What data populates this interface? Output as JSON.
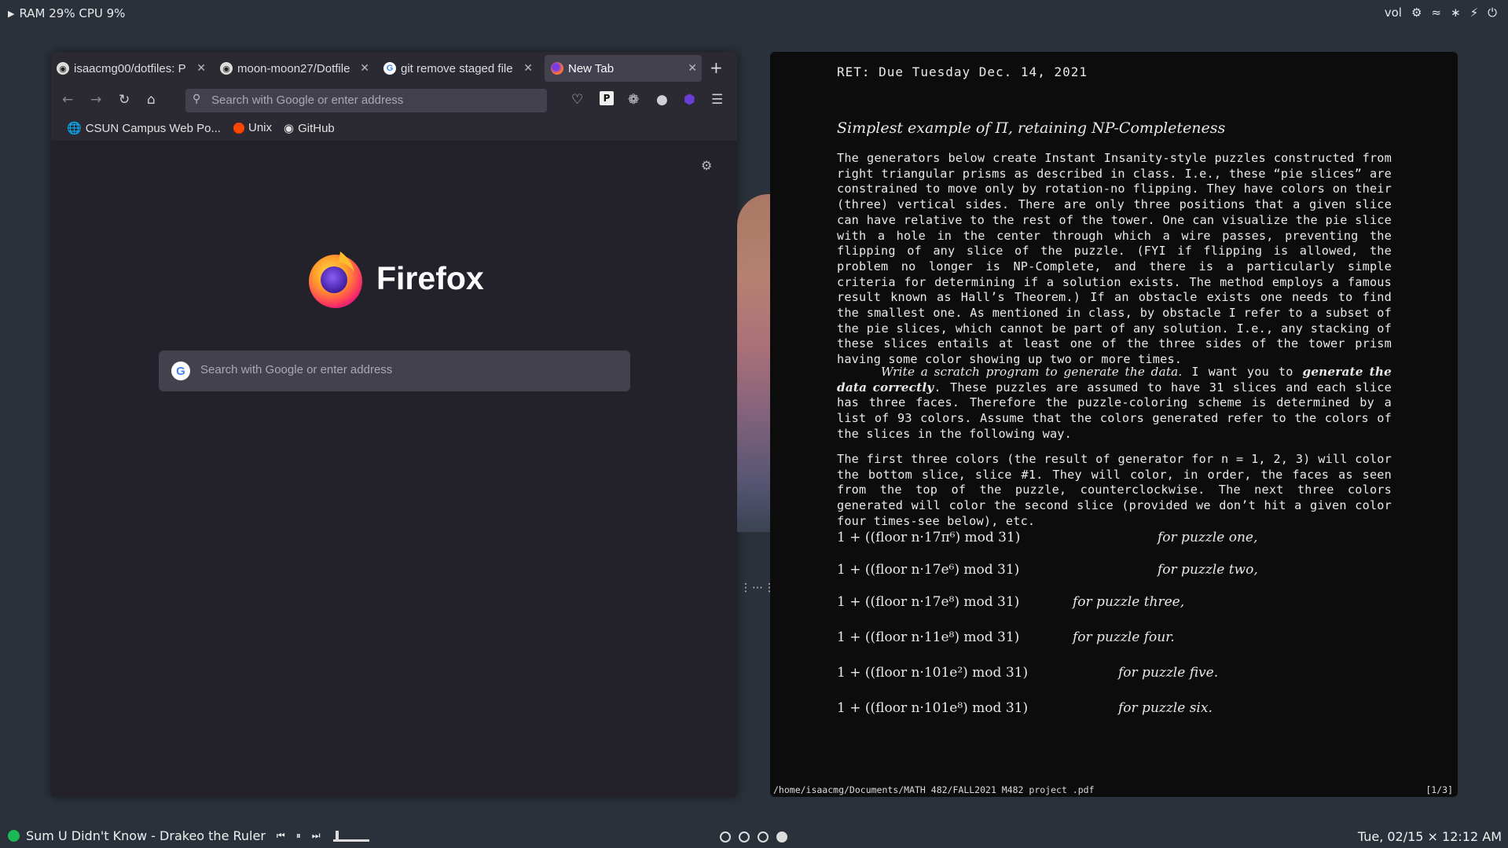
{
  "topbar": {
    "sysstat": "RAM 29% CPU 9%",
    "tray_vol": "vol"
  },
  "firefox": {
    "tabs": [
      {
        "label": "isaacmg00/dotfiles: P",
        "icon": "github-icon"
      },
      {
        "label": "moon-moon27/Dotfile",
        "icon": "github-icon"
      },
      {
        "label": "git remove staged file",
        "icon": "google-icon"
      },
      {
        "label": "New Tab",
        "icon": "firefox-icon"
      }
    ],
    "urlbar_placeholder": "Search with Google or enter address",
    "bookmarks": [
      {
        "label": "CSUN Campus Web Po..."
      },
      {
        "label": "Unix"
      },
      {
        "label": "GitHub"
      }
    ],
    "brand": "Firefox",
    "search_placeholder": "Search with Google or enter address"
  },
  "pdf": {
    "ret": "RET: Due Tuesday Dec. 14, 2021",
    "section_title": "Simplest example of Π, retaining NP-Completeness",
    "para1": "The generators below create Instant Insanity-style puzzles constructed from right triangular prisms as described in class. I.e., these “pie slices” are constrained to move only by rotation-no flipping. They have colors on their (three) vertical sides. There are only three positions that a given slice can have relative to the rest of the tower. One can visualize the pie slice with a hole in the center through which a wire passes, preventing the flipping of any slice of the puzzle. (FYI if flipping is allowed, the problem no longer is NP-Complete, and there is a particularly simple criteria for determining if a solution exists. The method employs a famous result known as Hall’s Theorem.) If an obstacle exists one needs to find the smallest one. As mentioned in class, by obstacle I refer to a subset of the pie slices, which cannot be part of any solution. I.e., any stacking of these slices entails at least one of the three sides of the tower prism having some color showing up two or more times.",
    "para2_italic": "Write a scratch program to generate the data.",
    "para2_mid": " I want you to ",
    "para2_bold": "generate the data correctly",
    "para2_rest": ". These puzzles are assumed to have 31 slices and each slice has three faces. Therefore the puzzle-coloring scheme is determined by a list of 93 colors. Assume that the colors generated refer to the colors of the slices in the following way.",
    "para3": "The first three colors (the result of generator for n = 1, 2, 3) will color the bottom slice, slice #1. They will color, in order, the faces as seen from the top of the puzzle, counterclockwise. The next three colors generated will color the second slice (provided we don’t hit a given color four times-see below), etc.",
    "formulas": [
      {
        "expr": "1 + ((floor n·17π⁶) mod 31)",
        "desc": "for puzzle one,"
      },
      {
        "expr": "1 + ((floor n·17e⁶) mod 31)",
        "desc": "for puzzle two,"
      },
      {
        "expr": "1 + ((floor n·17e⁸) mod 31)",
        "desc": "for puzzle three,"
      },
      {
        "expr": "1 + ((floor n·11e⁸) mod 31)",
        "desc": "for puzzle four."
      },
      {
        "expr": "1 + ((floor n·101e²) mod 31)",
        "desc": "for puzzle five."
      },
      {
        "expr": "1 + ((floor n·101e⁸) mod 31)",
        "desc": "for puzzle six."
      }
    ],
    "filepath": "/home/isaacmg/Documents/MATH 482/FALL2021 M482 project .pdf",
    "page": "[1/3]"
  },
  "bottombar": {
    "track": "Sum U Didn't Know - Drakeo the Ruler",
    "progress_fraction": 0.08,
    "clock": "Tue, 02/15 × 12:12 AM"
  }
}
